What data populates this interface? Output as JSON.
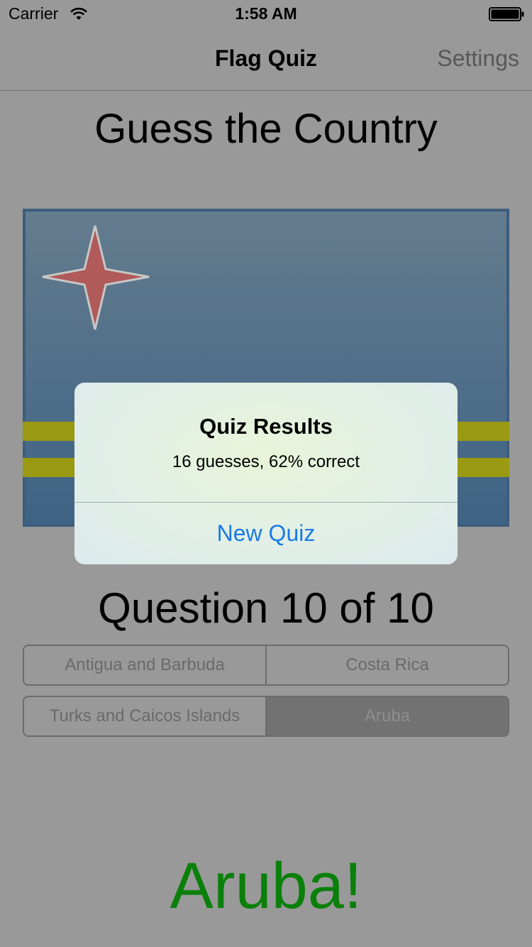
{
  "status_bar": {
    "carrier": "Carrier",
    "time": "1:58 AM",
    "wifi_icon": "wifi-icon",
    "battery_icon": "battery-icon"
  },
  "nav": {
    "title": "Flag Quiz",
    "settings_label": "Settings"
  },
  "quiz": {
    "heading": "Guess the Country",
    "question": "Question 10 of 10",
    "answers_row1": [
      "Antigua and Barbuda",
      "Costa Rica"
    ],
    "answers_row2": [
      "Turks and Caicos Islands",
      "Aruba"
    ],
    "selected_answer": "Aruba",
    "result": "Aruba!",
    "flag_icon": "aruba-flag"
  },
  "alert": {
    "title": "Quiz Results",
    "message": "16 guesses, 62% correct",
    "button_label": "New Quiz"
  },
  "colors": {
    "dim_background": "#999999",
    "result_green": "#0a800a",
    "alert_button_blue": "#1a7ae5",
    "flag_blue_dimmed": "#4b6a85",
    "flag_yellow_dimmed": "#9a9a12",
    "flag_star_red_dimmed": "#b05a5a"
  }
}
